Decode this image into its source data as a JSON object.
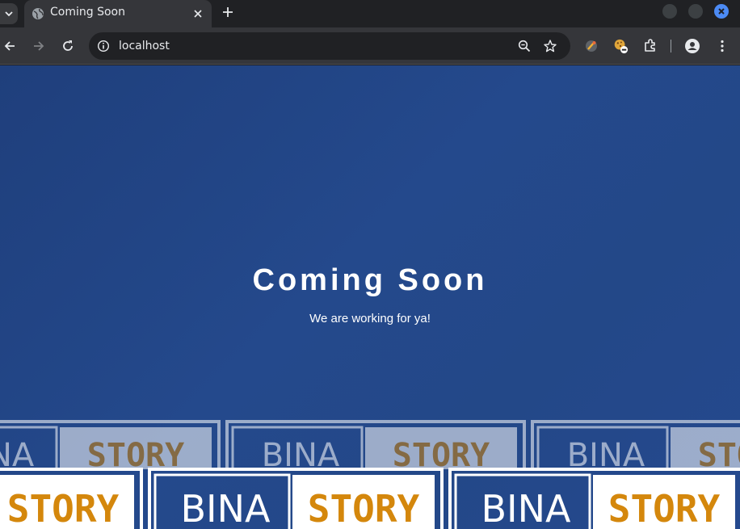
{
  "browser": {
    "tab": {
      "title": "Coming Soon",
      "favicon": "globe-icon"
    },
    "address_bar": {
      "url": "localhost"
    },
    "colors": {
      "frame": "#202124",
      "toolbar": "#35363a",
      "omnibox": "#202124",
      "close_accent": "#4c8bf5"
    }
  },
  "page": {
    "headline": "Coming Soon",
    "subline": "We are working for ya!",
    "logo": {
      "word_left": "BINA",
      "word_right": "STORY",
      "accent": "#d4870c"
    },
    "colors": {
      "background": "#23468a",
      "text": "#ffffff"
    }
  }
}
